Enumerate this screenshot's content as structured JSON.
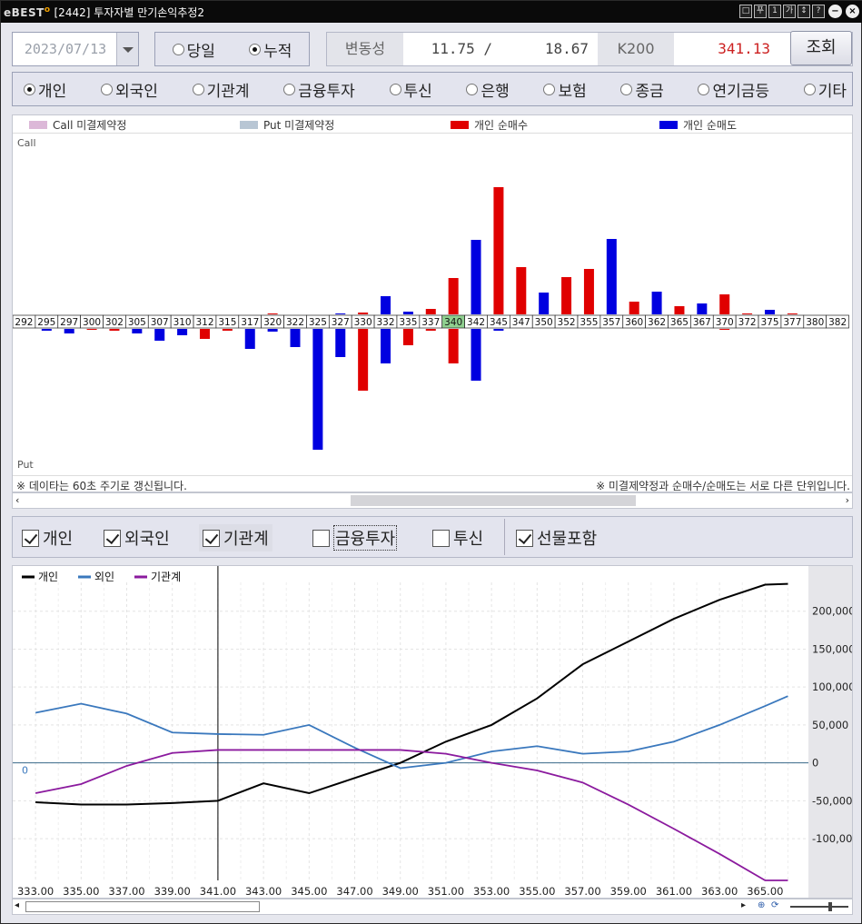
{
  "window": {
    "logo": "eBEST",
    "title": "[2442] 투자자별 만기손익추정2",
    "buttons": [
      "□",
      "푸",
      "1",
      "가",
      "↕",
      "?"
    ]
  },
  "controls": {
    "date": "2023/07/13",
    "period_options": [
      {
        "label": "당일",
        "selected": false
      },
      {
        "label": "누적",
        "selected": true
      }
    ],
    "volatility_label": "변동성",
    "volatility_value": "11.75 /      18.67",
    "k200_label": "K200",
    "k200_value": "341.13",
    "query_button": "조회"
  },
  "investors": [
    {
      "label": "개인",
      "selected": true
    },
    {
      "label": "외국인",
      "selected": false
    },
    {
      "label": "기관계",
      "selected": false
    },
    {
      "label": "금융투자",
      "selected": false
    },
    {
      "label": "투신",
      "selected": false
    },
    {
      "label": "은행",
      "selected": false
    },
    {
      "label": "보험",
      "selected": false
    },
    {
      "label": "종금",
      "selected": false
    },
    {
      "label": "연기금등",
      "selected": false
    },
    {
      "label": "기타",
      "selected": false
    }
  ],
  "chart_data": [
    {
      "type": "bar",
      "legend": [
        {
          "name": "Call 미결제약정",
          "color": "#dcb8d8"
        },
        {
          "name": "Put 미결제약정",
          "color": "#b8c6d4"
        },
        {
          "name": "개인 순매수",
          "color": "#e00000"
        },
        {
          "name": "개인 순매도",
          "color": "#0000e0"
        }
      ],
      "call_label": "Call",
      "put_label": "Put",
      "highlight_strike": "340",
      "strikes": [
        "292",
        "295",
        "297",
        "300",
        "302",
        "305",
        "307",
        "310",
        "312",
        "315",
        "317",
        "320",
        "322",
        "325",
        "327",
        "330",
        "332",
        "335",
        "337",
        "340",
        "342",
        "345",
        "347",
        "350",
        "352",
        "355",
        "357",
        "360",
        "362",
        "365",
        "367",
        "370",
        "372",
        "375",
        "377",
        "380",
        "382"
      ],
      "call": [
        0,
        0,
        0,
        0,
        0,
        0,
        0,
        0,
        0,
        0,
        0,
        1,
        0,
        0,
        1,
        2,
        20,
        3,
        6,
        40,
        82,
        140,
        52,
        24,
        41,
        50,
        83,
        14,
        25,
        9,
        12,
        22,
        1,
        5,
        1,
        0,
        0
      ],
      "call_colors": [
        "",
        "",
        "",
        "",
        "",
        "",
        "",
        "",
        "",
        "",
        "",
        "r",
        "",
        "",
        "b",
        "r",
        "b",
        "b",
        "r",
        "r",
        "b",
        "r",
        "r",
        "b",
        "r",
        "r",
        "b",
        "r",
        "b",
        "r",
        "b",
        "r",
        "r",
        "b",
        "r",
        "",
        ""
      ],
      "put": [
        0,
        -2,
        -5,
        -1,
        -2,
        -5,
        -13,
        -7,
        -11,
        -2,
        -22,
        -3,
        -20,
        -133,
        -31,
        -68,
        -38,
        -18,
        -2,
        -38,
        -57,
        -2,
        0,
        0,
        0,
        0,
        0,
        0,
        0,
        0,
        0,
        -1,
        0,
        0,
        0,
        0,
        0
      ],
      "put_colors": [
        "",
        "b",
        "b",
        "r",
        "r",
        "b",
        "b",
        "b",
        "r",
        "r",
        "b",
        "b",
        "b",
        "b",
        "b",
        "r",
        "b",
        "r",
        "r",
        "r",
        "b",
        "b",
        "",
        "",
        "",
        "",
        "",
        "",
        "",
        "",
        "",
        "r",
        "",
        "",
        "",
        "",
        ""
      ],
      "notes": {
        "left": "※ 데이타는 60초 주기로 갱신됩니다.",
        "right": "※ 미결제약정과 순매수/순매도는 서로 다른 단위입니다."
      }
    },
    {
      "type": "line",
      "x": [
        333,
        335,
        337,
        339,
        341,
        343,
        345,
        347,
        349,
        351,
        353,
        355,
        357,
        359,
        361,
        363,
        365,
        366
      ],
      "x_tick_labels": [
        "333.00",
        "335.00",
        "337.00",
        "339.00",
        "341.00",
        "343.00",
        "345.00",
        "347.00",
        "349.00",
        "351.00",
        "353.00",
        "355.00",
        "357.00",
        "359.00",
        "361.00",
        "363.00",
        "365.00"
      ],
      "ylim": [
        -155000,
        238000
      ],
      "y_tick_labels": [
        "200,000",
        "150,000",
        "100,000",
        "50,000",
        "0",
        "-50,000",
        "-100,000"
      ],
      "y_ticks": [
        200000,
        150000,
        100000,
        50000,
        0,
        -50000,
        -100000
      ],
      "zero_label": "0",
      "cursor_x": 341,
      "series": [
        {
          "name": "개인",
          "color": "#000000",
          "values": [
            -52000,
            -55000,
            -55000,
            -53000,
            -50000,
            -27000,
            -40000,
            -20000,
            0,
            28000,
            50000,
            85000,
            130000,
            160000,
            190000,
            215000,
            235000,
            236000
          ]
        },
        {
          "name": "외인",
          "color": "#3a78bd",
          "values": [
            66000,
            78000,
            65000,
            40000,
            38000,
            37000,
            50000,
            20000,
            -7000,
            0,
            15000,
            22000,
            12000,
            15000,
            28000,
            50000,
            75000,
            88000
          ]
        },
        {
          "name": "기관계",
          "color": "#8b1a9e",
          "values": [
            -40000,
            -28000,
            -4000,
            13000,
            17000,
            17000,
            17000,
            17000,
            17000,
            12000,
            0,
            -10000,
            -26000,
            -55000,
            -87000,
            -120000,
            -155000,
            -155000
          ]
        }
      ]
    }
  ],
  "bottom_toggles": [
    {
      "label": "개인",
      "checked": true
    },
    {
      "label": "외국인",
      "checked": true
    },
    {
      "label": "기관계",
      "checked": true
    },
    {
      "label": "금융투자",
      "checked": false
    },
    {
      "label": "투신",
      "checked": false
    },
    {
      "label": "선물포함",
      "checked": true
    }
  ]
}
